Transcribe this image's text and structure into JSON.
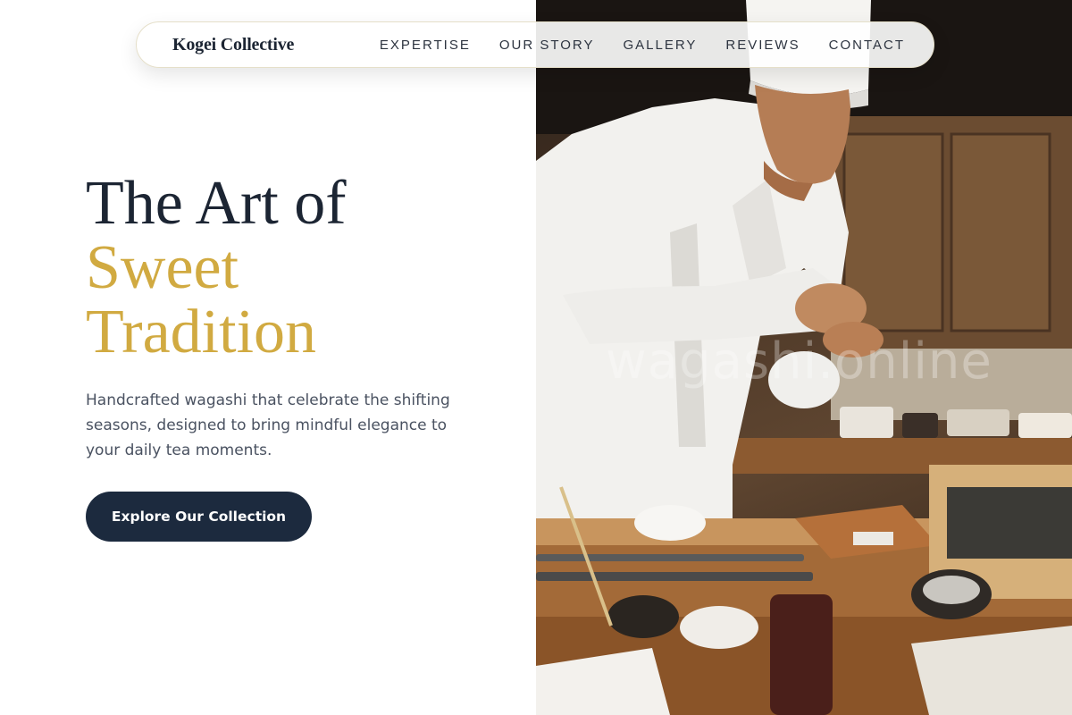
{
  "nav": {
    "brand": "Kogei Collective",
    "links": [
      "EXPERTISE",
      "OUR STORY",
      "GALLERY",
      "REVIEWS",
      "CONTACT"
    ]
  },
  "hero": {
    "title_line1": "The Art of",
    "title_accent_line1": "Sweet",
    "title_accent_line2": "Tradition",
    "subtitle": "Handcrafted wagashi that celebrate the shifting seasons, designed to bring mindful elegance to your daily tea moments.",
    "cta_label": "Explore Our Collection"
  },
  "photo": {
    "watermark": "wagashi.online"
  },
  "colors": {
    "navy": "#1c2a3e",
    "gold": "#d1aa41",
    "text_muted": "#4a5261"
  }
}
